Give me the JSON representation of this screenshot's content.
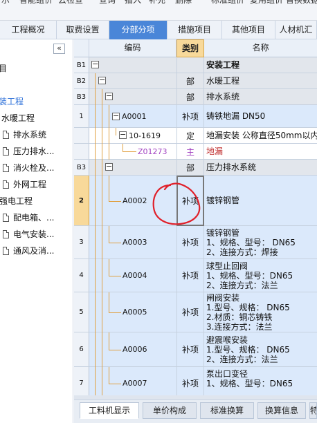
{
  "topbar": {
    "items": [
      "示",
      "智能组价",
      "云检查",
      "查询",
      "插入",
      "补充",
      "删除",
      "标准组价",
      "复用组价",
      "替换数据"
    ]
  },
  "tabs": [
    {
      "label": "工程概况"
    },
    {
      "label": "取费设置"
    },
    {
      "label": "分部分项"
    },
    {
      "label": "措施项目"
    },
    {
      "label": "其他项目"
    },
    {
      "label": "人材机汇"
    }
  ],
  "sidebar": {
    "collapse_glyph": "«",
    "items": [
      {
        "label": "目"
      },
      {
        "label": "装工程"
      },
      {
        "label": "水暖工程"
      },
      {
        "label": "排水系统"
      },
      {
        "label": "压力排水..."
      },
      {
        "label": "消火栓及..."
      },
      {
        "label": "外网工程"
      },
      {
        "label": "强电工程"
      },
      {
        "label": "配电箱、..."
      },
      {
        "label": "电气安装..."
      },
      {
        "label": "通风及消..."
      }
    ]
  },
  "grid": {
    "headers": {
      "code": "编码",
      "type": "类别",
      "name": "名称"
    },
    "rows": [
      {
        "rownum": "B1",
        "code": "",
        "type": "",
        "name": "安装工程",
        "lines": []
      },
      {
        "rownum": "B2",
        "code": "",
        "type": "部",
        "name": "水暖工程",
        "lines": []
      },
      {
        "rownum": "B3",
        "code": "",
        "type": "部",
        "name": "排水系统",
        "lines": []
      },
      {
        "rownum": "1",
        "code": "A0001",
        "type": "补项",
        "name": "铸铁地漏 DN50",
        "lines": []
      },
      {
        "rownum": "",
        "code": "10-1619",
        "type": "定",
        "name": "地漏安装 公称直径50mm以内",
        "lines": []
      },
      {
        "rownum": "",
        "code": "Z01273",
        "type": "主",
        "name": "地漏",
        "lines": []
      },
      {
        "rownum": "B3",
        "code": "",
        "type": "部",
        "name": "压力排水系统",
        "lines": []
      },
      {
        "rownum": "2",
        "code": "A0002",
        "type": "补项",
        "name": "镀锌钢管",
        "lines": []
      },
      {
        "rownum": "3",
        "code": "A0003",
        "type": "补项",
        "name": "",
        "lines": [
          "镀锌钢管",
          "1、规格、型号： DN65",
          "2、连接方式：焊接"
        ]
      },
      {
        "rownum": "4",
        "code": "A0004",
        "type": "补项",
        "name": "",
        "lines": [
          "球型止回阀",
          "1、规格、型号：DN65",
          "2、连接方式：法兰"
        ]
      },
      {
        "rownum": "5",
        "code": "A0005",
        "type": "补项",
        "name": "",
        "lines": [
          "闸阀安装",
          "1.型号、规格： DN65",
          "2.材质：铜芯铸铁",
          "3.连接方式：法兰"
        ]
      },
      {
        "rownum": "6",
        "code": "A0006",
        "type": "补项",
        "name": "",
        "lines": [
          "避震喉安装",
          "1.型号、规格： DN65",
          "2、连接方式：法兰"
        ]
      },
      {
        "rownum": "7",
        "code": "A0007",
        "type": "补项",
        "name": "",
        "lines": [
          "泵出口变径",
          "1、规格、型号：DN65"
        ]
      }
    ]
  },
  "bottom_tabs": [
    {
      "label": "工料机显示"
    },
    {
      "label": "单价构成"
    },
    {
      "label": "标准换算"
    },
    {
      "label": "换算信息"
    },
    {
      "label": "特"
    }
  ],
  "colors": {
    "tab_active": "#4a86d8",
    "row_selected": "#dbe9fb",
    "header_type": "#f8d99a",
    "annotation": "#e0202a",
    "tree_blue": "#2a6ed8"
  }
}
